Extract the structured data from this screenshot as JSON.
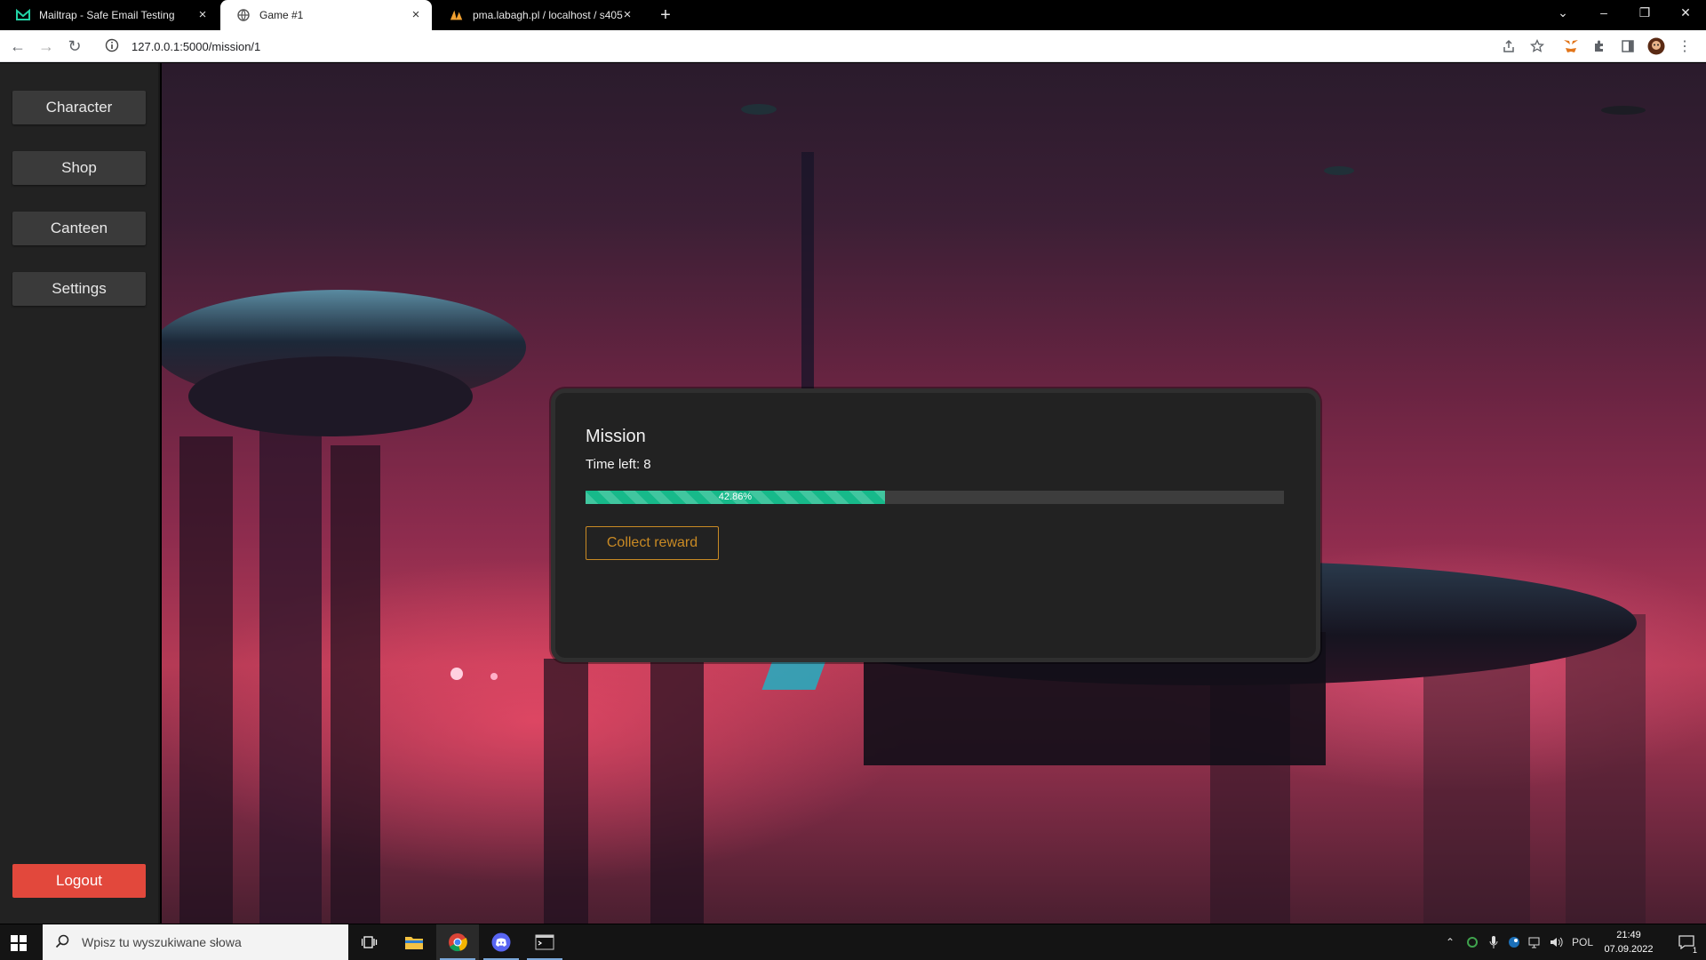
{
  "browser": {
    "tabs": [
      {
        "title": "Mailtrap - Safe Email Testing",
        "icon": "mailtrap-icon",
        "active": false
      },
      {
        "title": "Game #1",
        "icon": "globe-icon",
        "active": true
      },
      {
        "title": "pma.labagh.pl / localhost / s405",
        "icon": "phpmyadmin-icon",
        "active": false
      }
    ],
    "new_tab_label": "+",
    "url": "127.0.0.1:5000/mission/1",
    "window_controls": [
      "chevron-down-icon",
      "minimize-icon",
      "restore-icon",
      "close-icon"
    ]
  },
  "sidebar": {
    "items": [
      {
        "label": "Character"
      },
      {
        "label": "Shop"
      },
      {
        "label": "Canteen"
      },
      {
        "label": "Settings"
      }
    ],
    "logout_label": "Logout"
  },
  "mission": {
    "title": "Mission",
    "time_left_label": "Time left: 8",
    "progress_value": 42.86,
    "progress_text": "42.86%",
    "collect_label": "Collect reward"
  },
  "taskbar": {
    "search_placeholder": "Wpisz tu wyszukiwane słowa",
    "language": "POL",
    "time": "21:49",
    "date": "07.09.2022",
    "notification_count": "1"
  },
  "colors": {
    "progress_fill": "#17b98a",
    "collect_accent": "#c98a24",
    "logout_bg": "#e2483c",
    "sidebar_bg": "#222222"
  }
}
